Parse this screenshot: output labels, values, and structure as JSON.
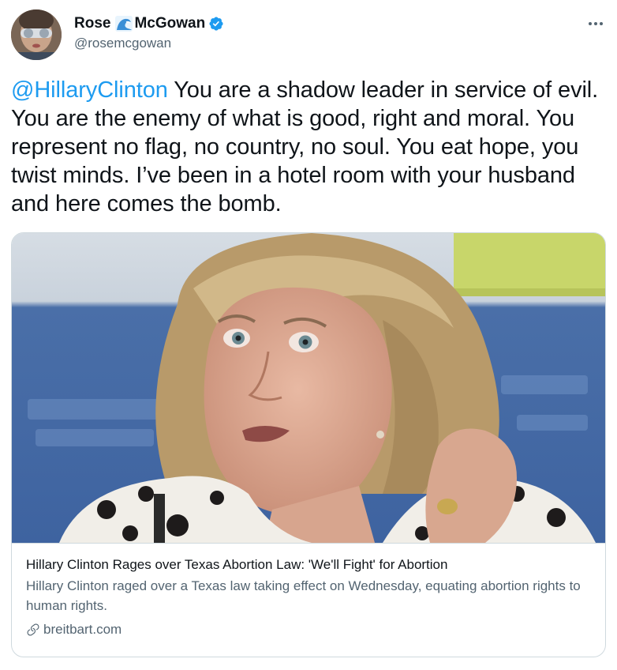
{
  "author": {
    "name_first": "Rose",
    "name_last": "McGowan",
    "name_emoji_icon": "water-wave-icon",
    "verified_icon": "verified-badge-icon",
    "handle": "@rosemcgowan"
  },
  "menu_icon": "more-options-icon",
  "tweet": {
    "mention": "@HillaryClinton",
    "text": " You are a shadow leader in service of evil. You are the enemy of what is good, right and moral. You represent no flag, no country, no soul. You eat hope, you twist minds. I’ve been in a hotel room with your husband and here comes the bomb."
  },
  "card": {
    "image_icon": "photo-of-woman-speaking",
    "title": "Hillary Clinton Rages over Texas Abortion Law: 'We'll Fight' for Abortion",
    "description": "Hillary Clinton raged over a Texas law taking effect on Wednesday, equating abortion rights to human rights.",
    "domain": "breitbart.com",
    "domain_icon": "link-icon"
  },
  "colors": {
    "link_blue": "#1d9bf0",
    "text_primary": "#0f1419",
    "text_secondary": "#536471",
    "border": "#cfd9de"
  }
}
